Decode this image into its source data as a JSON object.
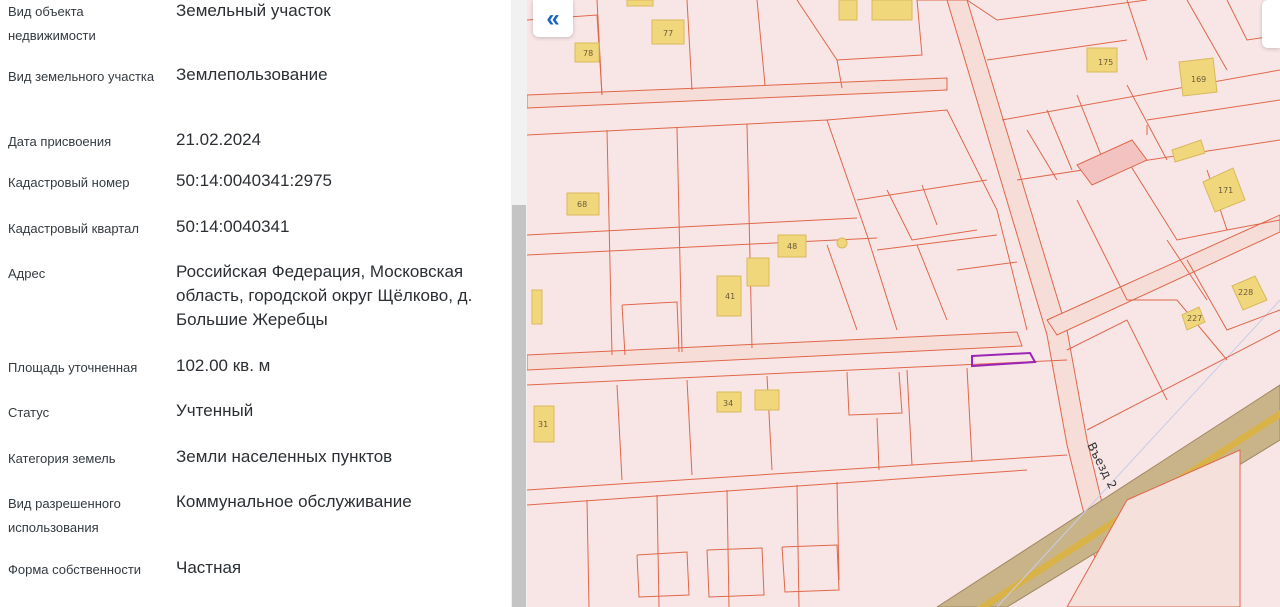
{
  "fields": [
    {
      "label": "Вид объекта недвижимости",
      "value": "Земельный участок"
    },
    {
      "label": "Вид земельного участка",
      "value": "Землепользование"
    },
    {
      "label": "Дата присвоения",
      "value": "21.02.2024"
    },
    {
      "label": "Кадастровый номер",
      "value": "50:14:0040341:2975"
    },
    {
      "label": "Кадастровый квартал",
      "value": "50:14:0040341"
    },
    {
      "label": "Адрес",
      "value": "Российская Федерация, Московская область, городской округ Щёлково, д. Большие Жеребцы"
    },
    {
      "label": "Площадь уточненная",
      "value": "102.00 кв. м"
    },
    {
      "label": "Статус",
      "value": "Учтенный"
    },
    {
      "label": "Категория земель",
      "value": "Земли населенных пунктов"
    },
    {
      "label": "Вид разрешенного использования",
      "value": "Коммунальное обслуживание"
    },
    {
      "label": "Форма собственности",
      "value": "Частная"
    }
  ],
  "map": {
    "collapse_button_glyph": "«",
    "street_name": "Въезд 2",
    "parcel_labels": [
      "78",
      "77",
      "175",
      "169",
      "68",
      "48",
      "41",
      "171",
      "228",
      "227",
      "34",
      "31"
    ],
    "colors": {
      "background": "#f8e6e7",
      "parcel_border": "#e0674a",
      "building": "#f0d77c",
      "selected_parcel": "#9b26b6",
      "road": "#f6ddd7",
      "railway": "#c9b48a",
      "accent": "#1a64c8"
    }
  }
}
